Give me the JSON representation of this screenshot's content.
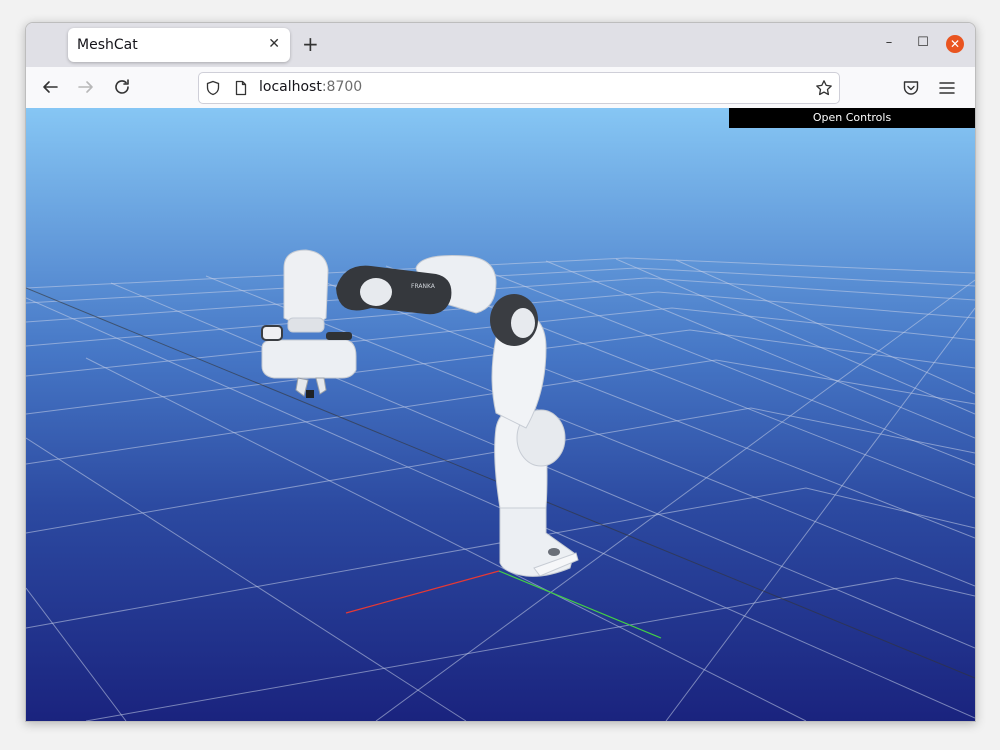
{
  "browser": {
    "tab_title": "MeshCat",
    "tab_close": "✕",
    "new_tab": "+",
    "url_host": "localhost",
    "url_port": ":8700",
    "window_controls": {
      "minimize": "–",
      "maximize": "☐",
      "close": "✕"
    }
  },
  "viewer": {
    "open_controls": "Open Controls",
    "robot_label": "FRANKA"
  },
  "colors": {
    "sky_top": "#86c6f4",
    "sky_bottom": "#1a237e",
    "x_axis": "#e53935",
    "y_axis": "#43d243",
    "z_axis": "#3a5bd8",
    "close_button": "#e95420"
  },
  "icons": [
    "back-arrow-icon",
    "forward-arrow-icon",
    "reload-icon",
    "shield-icon",
    "page-icon",
    "star-icon",
    "pocket-icon",
    "hamburger-menu-icon",
    "close-icon",
    "minimize-icon",
    "maximize-icon",
    "plus-icon"
  ]
}
